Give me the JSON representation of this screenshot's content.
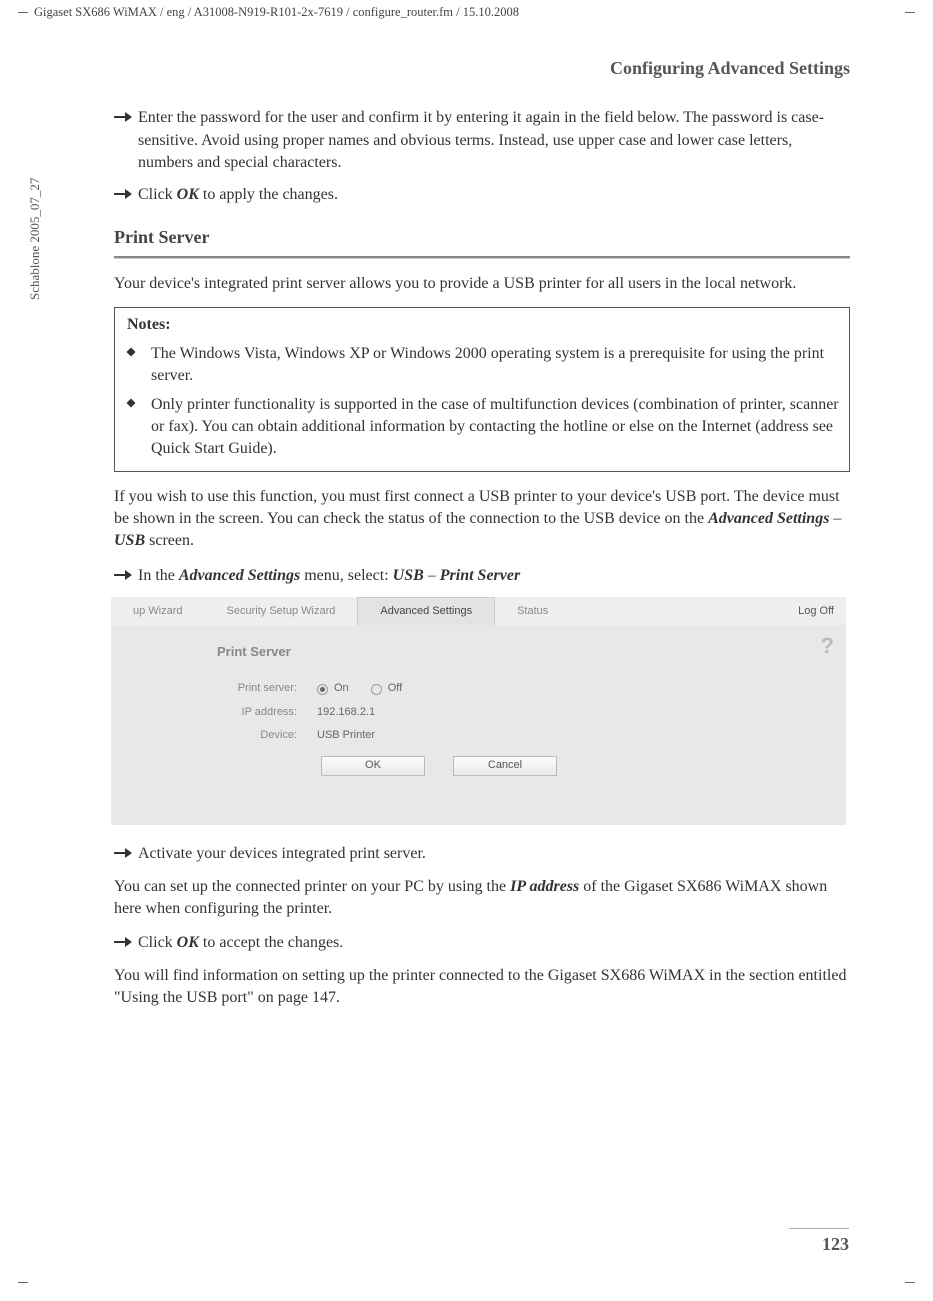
{
  "meta": {
    "header_path": "Gigaset SX686 WiMAX / eng / A31008-N919-R101-2x-7619 / configure_router.fm / 15.10.2008",
    "side_label": "Schablone 2005_07_27",
    "page_number": "123"
  },
  "section_title": "Configuring Advanced Settings",
  "steps_top": [
    "Enter the password for the user and confirm it by entering it again in the field below. The password is case-sensitive. Avoid using proper names and obvious terms. Instead, use upper case and lower case letters, numbers and special characters.",
    "Click OK to apply the changes."
  ],
  "subhead": "Print Server",
  "para1": "Your device's integrated print server allows you to provide a USB printer for all users in the local network.",
  "notes": {
    "title": "Notes:",
    "items": [
      "The Windows Vista, Windows XP or Windows 2000 operating system is a prerequisite for using the print server.",
      "Only printer functionality is supported in the case of multifunction devices (combination of printer, scanner or fax). You can obtain additional information by contacting the hotline or else on the Internet (address see Quick Start Guide)."
    ]
  },
  "para2": "If you wish to use this function, you must first connect a USB printer to your device's USB port. The device must be shown in the screen. You can check the status of the connection to the USB device on the Advanced Settings – USB screen.",
  "step_nav": "In the Advanced Settings menu, select: USB – Print Server",
  "ui": {
    "tabs": {
      "setup": "up Wizard",
      "security": "Security Setup Wizard",
      "advanced": "Advanced Settings",
      "status": "Status",
      "logoff": "Log Off"
    },
    "title": "Print Server",
    "labels": {
      "print_server": "Print server:",
      "ip_address": "IP address:",
      "device": "Device:"
    },
    "values": {
      "on": "On",
      "off": "Off",
      "ip": "192.168.2.1",
      "device": "USB Printer"
    },
    "buttons": {
      "ok": "OK",
      "cancel": "Cancel"
    },
    "help": "?"
  },
  "steps_bottom": [
    "Activate your devices integrated print server."
  ],
  "para3": "You can set up the connected printer on your PC by using the IP address of the Gigaset SX686 WiMAX shown here when configuring the printer.",
  "step_ok2": "Click OK to accept the changes.",
  "para4": "You will find information on setting up the printer connected to the Gigaset SX686 WiMAX in the section entitled \"Using the USB port\" on page 147."
}
